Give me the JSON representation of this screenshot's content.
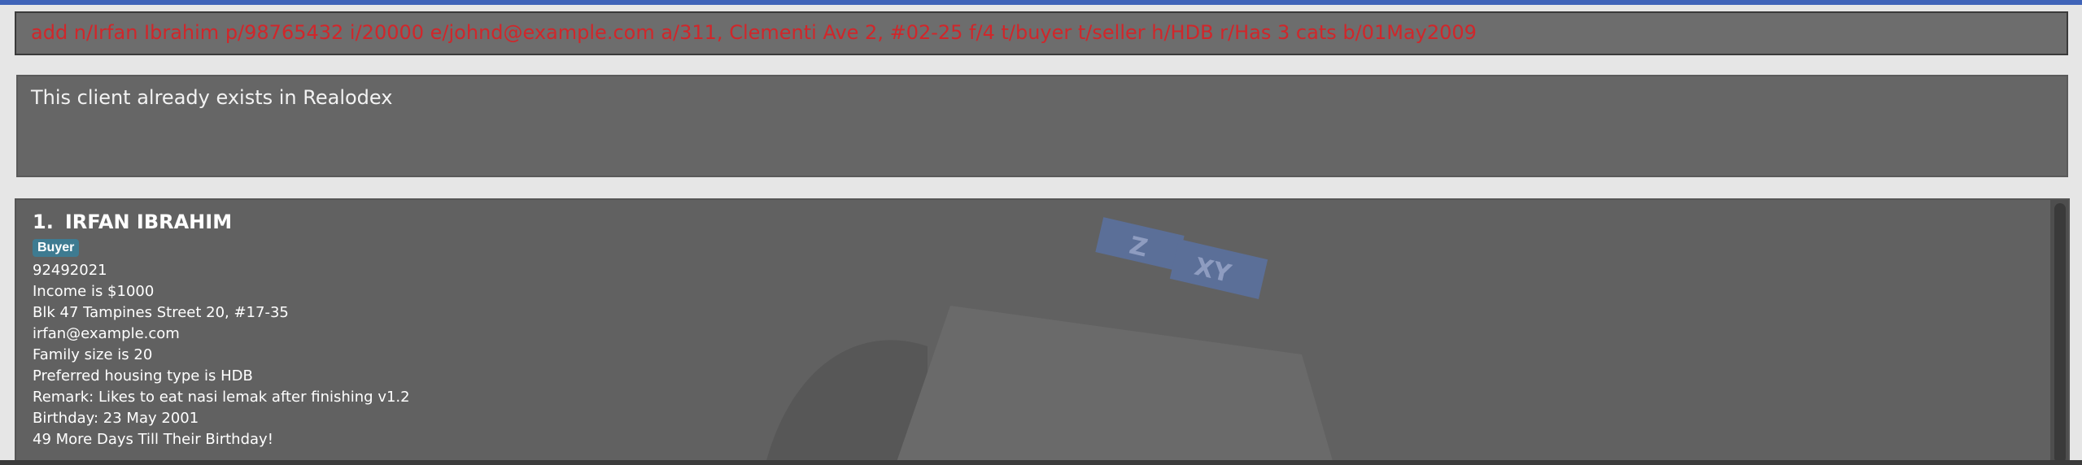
{
  "command_box": {
    "text": "add n/Irfan Ibrahim p/98765432 i/20000 e/johnd@example.com a/311, Clementi Ave 2, #02-25 f/4 t/buyer t/seller h/HDB r/Has 3 cats b/01May2009",
    "color": "#d1262a"
  },
  "result_display": {
    "text": "This client already exists in Realodex"
  },
  "client_list": {
    "items": [
      {
        "index": "1.",
        "name": "IRFAN IBRAHIM",
        "tags": [
          "Buyer"
        ],
        "phone": "92492021",
        "income": "Income is $1000",
        "address": "Blk 47 Tampines Street 20, #17-35",
        "email": "irfan@example.com",
        "family": "Family size is 20",
        "housing": "Preferred housing type is HDB",
        "remark": "Remark: Likes to eat nasi lemak after finishing v1.2",
        "birthday": "Birthday: 23 May 2001",
        "countdown": "49 More Days Till Their Birthday!"
      }
    ],
    "background_art": {
      "labels": [
        "Z",
        "XY"
      ]
    }
  },
  "colors": {
    "accent": "#3f63b8",
    "tag": "#3e7b91",
    "panel": "#616161"
  }
}
